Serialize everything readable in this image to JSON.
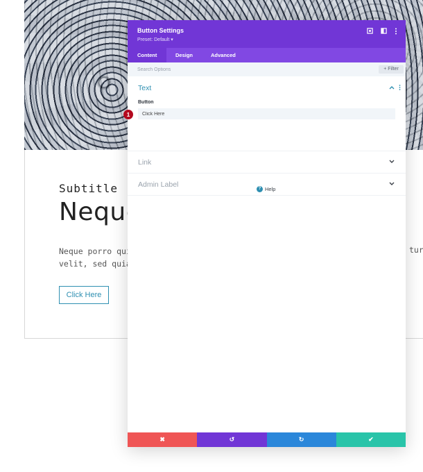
{
  "page": {
    "subtitle": "Subtitle",
    "title": "Neque",
    "body_line1": "Neque porro qui",
    "body_line2": "velit, sed quia",
    "body_tail": "tur,",
    "button_label": "Click Here"
  },
  "modal": {
    "title": "Button Settings",
    "preset": "Preset: Default ▾",
    "header_icons": [
      "expand-icon",
      "split-view-icon",
      "more-vertical-icon"
    ],
    "tabs": [
      {
        "label": "Content",
        "active": true
      },
      {
        "label": "Design",
        "active": false
      },
      {
        "label": "Advanced",
        "active": false
      }
    ],
    "search": {
      "placeholder": "Search Options",
      "filter_label": "+ Filter"
    },
    "sections": {
      "text": {
        "label": "Text",
        "field_label": "Button",
        "field_value": "Click Here",
        "step_badge": "1"
      },
      "link": {
        "label": "Link"
      },
      "admin": {
        "label": "Admin Label"
      }
    },
    "help_label": "Help",
    "footer": {
      "cancel": "✖",
      "undo": "↺",
      "redo": "↻",
      "save": "✔"
    },
    "colors": {
      "header": "#7136d6",
      "tabs": "#8148e3",
      "accent": "#2e8fb1",
      "cancel": "#ef5555",
      "redo": "#2b87da",
      "save": "#29c4a9",
      "badge": "#b3091f"
    }
  }
}
